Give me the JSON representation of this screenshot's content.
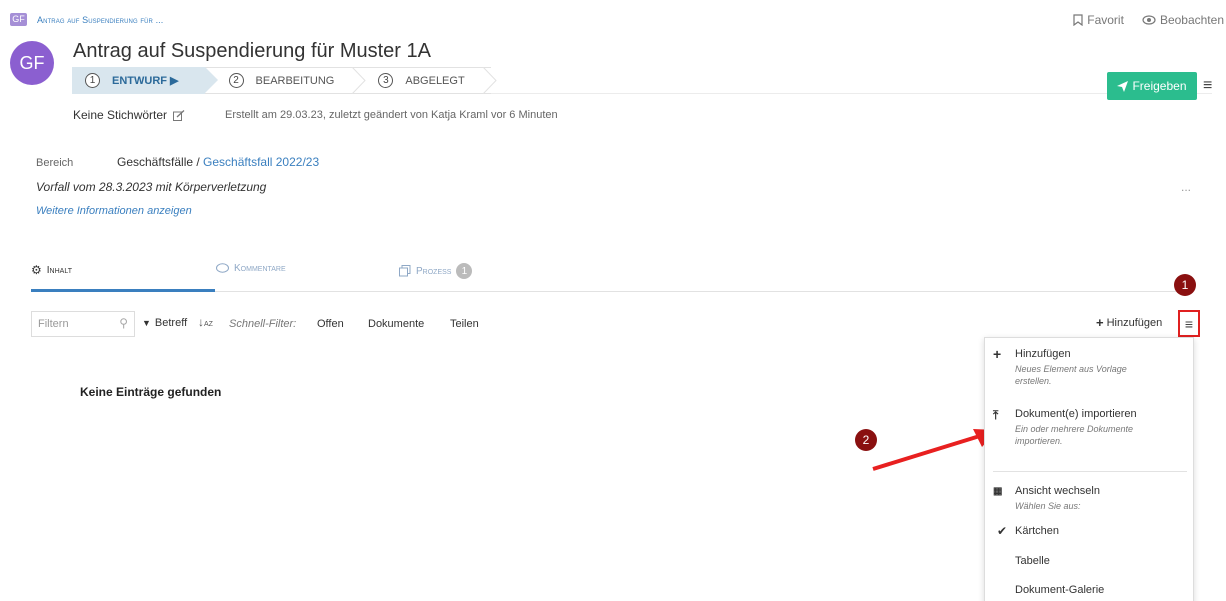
{
  "breadcrumb": {
    "badge": "GF",
    "text": "Antrag auf Suspendierung für ..."
  },
  "top_actions": {
    "favorit": "Favorit",
    "beobachten": "Beobachten"
  },
  "header": {
    "avatar": "GF",
    "title": "Antrag auf Suspendierung für Muster 1A",
    "keywords": "Keine Stichwörter",
    "created": "Erstellt am 29.03.23, zuletzt geändert von Katja Kraml  vor 6 Minuten"
  },
  "stepper": [
    {
      "num": "1",
      "label": "Entwurf ▶",
      "active": true
    },
    {
      "num": "2",
      "label": "Bearbeitung",
      "active": false
    },
    {
      "num": "3",
      "label": "Abgelegt",
      "active": false
    }
  ],
  "freigeben": {
    "label": "Freigeben",
    "color": "#2bbd8e"
  },
  "info": {
    "bereich_label": "Bereich",
    "bereich_value": "Geschäftsfälle / ",
    "bereich_link": "Geschäftsfall 2022/23",
    "vorfall": "Vorfall vom 28.3.2023 mit Körperverletzung",
    "weitere": "Weitere Informationen anzeigen",
    "more": "..."
  },
  "tabs": {
    "inhalt": "Inhalt",
    "kommentare": "Kommentare",
    "prozess": "Prozess",
    "prozess_count": "1"
  },
  "filter": {
    "placeholder": "Filtern",
    "sort_label": "Betreff",
    "quick_label": "Schnell-Filter:",
    "quick_items": [
      "Offen",
      "Dokumente",
      "Teilen"
    ],
    "add_label": "Hinzufügen"
  },
  "markers": {
    "one": "1",
    "two": "2"
  },
  "empty_message": "Keine Einträge gefunden",
  "dropdown": {
    "add_title": "Hinzufügen",
    "add_desc": "Neues Element aus Vorlage erstellen.",
    "import_title": "Dokument(e) importieren",
    "import_desc": "Ein oder mehrere Dokumente importieren.",
    "view_title": "Ansicht wechseln",
    "view_desc": "Wählen Sie aus:",
    "view_options": [
      "Kärtchen",
      "Tabelle",
      "Dokument-Galerie"
    ],
    "selected_view": "Kärtchen"
  },
  "colors": {
    "accent": "#3a7fbf",
    "marker": "#8a1010",
    "highlight": "#e02020"
  }
}
